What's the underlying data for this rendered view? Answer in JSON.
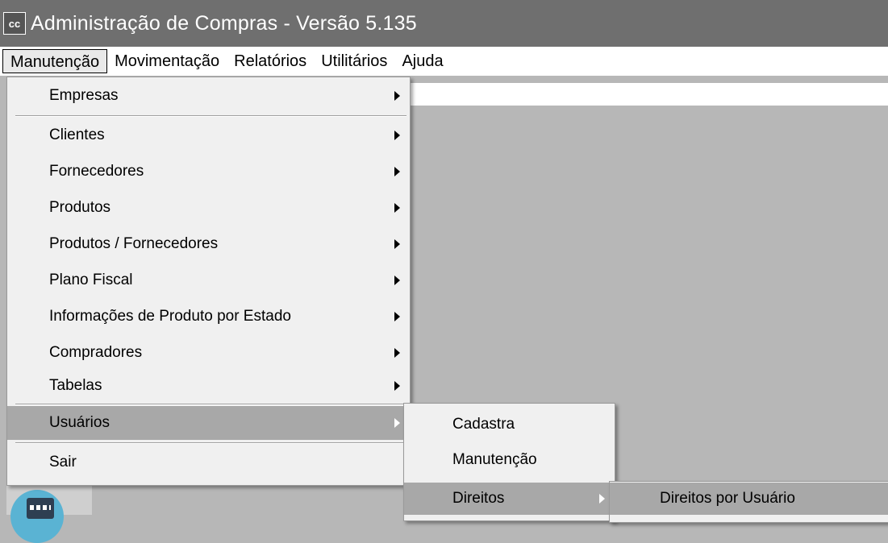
{
  "window": {
    "title": "Administração de Compras - Versão 5.135",
    "icon_text": "cc",
    "icon": "app-cc-icon"
  },
  "menubar": {
    "items": [
      "Manutenção",
      "Movimentação",
      "Relatórios",
      "Utilitários",
      "Ajuda"
    ]
  },
  "manutencao_menu": {
    "items": [
      {
        "label": "Empresas"
      },
      {
        "label": "Clientes"
      },
      {
        "label": "Fornecedores"
      },
      {
        "label": "Produtos"
      },
      {
        "label": "Produtos / Fornecedores"
      },
      {
        "label": "Plano Fiscal"
      },
      {
        "label": "Informações de Produto por Estado"
      },
      {
        "label": "Compradores"
      },
      {
        "label": "Tabelas"
      },
      {
        "label": "Usuários"
      },
      {
        "label": "Sair"
      }
    ]
  },
  "usuarios_submenu": {
    "items": [
      {
        "label": "Cadastra"
      },
      {
        "label": "Manutenção"
      },
      {
        "label": "Direitos"
      }
    ]
  },
  "direitos_submenu": {
    "items": [
      {
        "label": "Direitos por Usuário"
      }
    ]
  },
  "colors": {
    "titlebar": "#6f6f6f",
    "menu_bg": "#f0f0f0",
    "highlight": "#a8a8a8",
    "workspace": "#b7b7b7"
  },
  "taskbar_icon": "calendar-icon"
}
